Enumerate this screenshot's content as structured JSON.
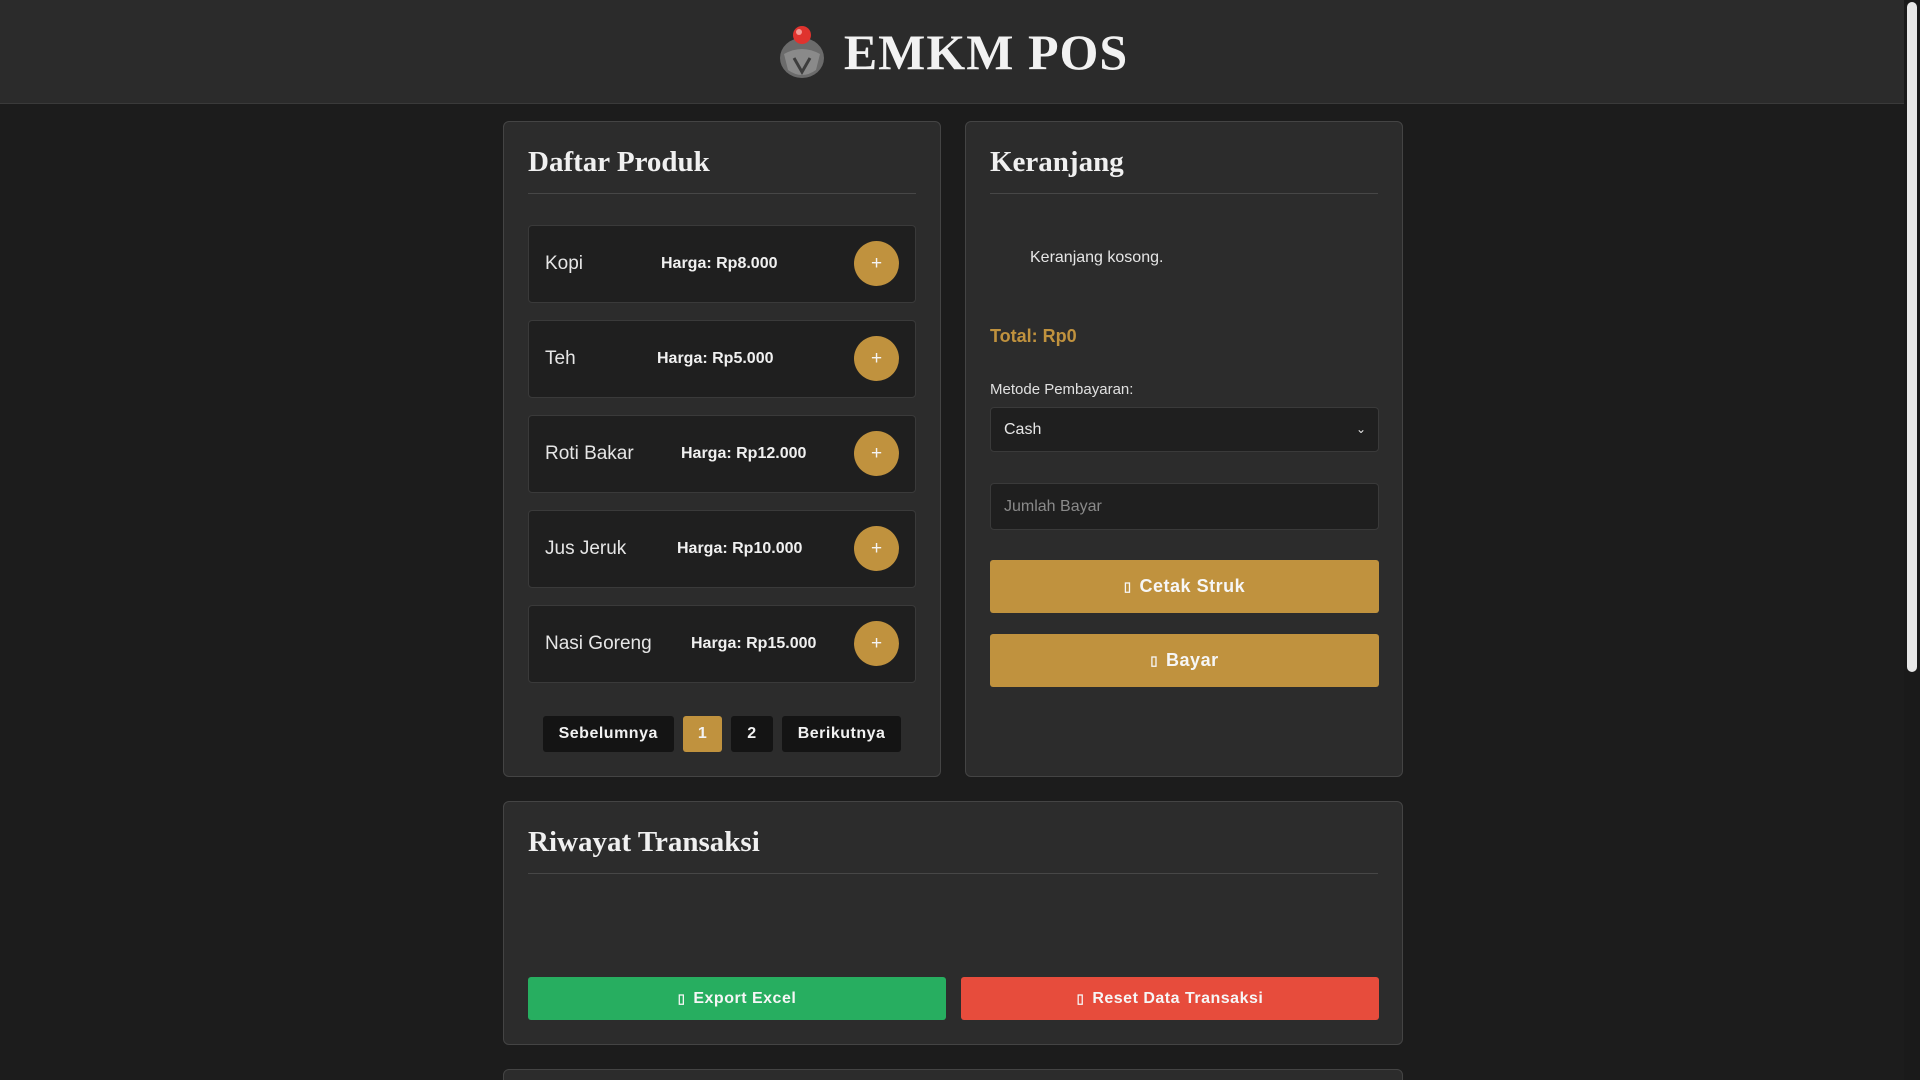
{
  "app": {
    "title": "EMKM POS"
  },
  "produk": {
    "title": "Daftar Produk",
    "items": [
      {
        "name": "Kopi",
        "price": "Harga: Rp8.000",
        "add_label": "+"
      },
      {
        "name": "Teh",
        "price": "Harga: Rp5.000",
        "add_label": "+"
      },
      {
        "name": "Roti Bakar",
        "price": "Harga: Rp12.000",
        "add_label": "+"
      },
      {
        "name": "Jus Jeruk",
        "price": "Harga: Rp10.000",
        "add_label": "+"
      },
      {
        "name": "Nasi Goreng",
        "price": "Harga: Rp15.000",
        "add_label": "+"
      }
    ],
    "pagination": {
      "prev": "Sebelumnya",
      "page1": "1",
      "page2": "2",
      "next": "Berikutnya",
      "current_page": 1
    }
  },
  "keranjang": {
    "title": "Keranjang",
    "empty_text": "Keranjang kosong.",
    "total": "Total: Rp0",
    "payment_label": "Metode Pembayaran:",
    "payment_selected": "Cash",
    "amount_placeholder": "Jumlah Bayar",
    "print_button": "Cetak Struk",
    "pay_button": "Bayar"
  },
  "riwayat": {
    "title": "Riwayat Transaksi",
    "export_button": "Export Excel",
    "reset_button": "Reset Data Transaksi"
  },
  "colors": {
    "accent": "#c0923e",
    "export": "#27ae60",
    "reset": "#e74c3c",
    "background": "#1c1c1c",
    "panel": "#2c2c2c"
  },
  "icons": {
    "logo": "pos-robot-logo-icon",
    "print": "print-icon",
    "pay": "money-icon",
    "export": "file-excel-icon",
    "reset": "trash-icon",
    "select": "chevron-down-icon"
  }
}
